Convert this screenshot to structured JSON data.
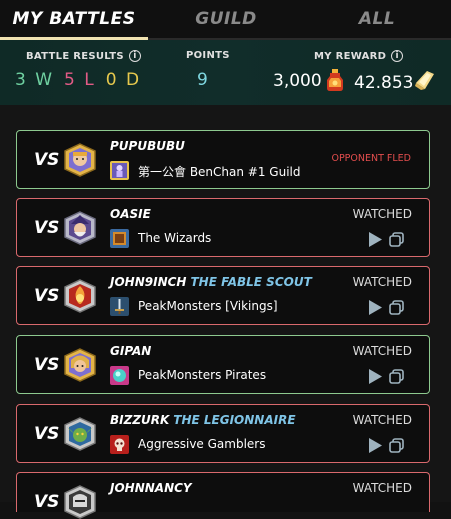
{
  "tabs": [
    {
      "label": "MY BATTLES",
      "active": true
    },
    {
      "label": "GUILD",
      "active": false
    },
    {
      "label": "ALL",
      "active": false
    }
  ],
  "stats": {
    "battle_results_label": "BATTLE RESULTS",
    "wins": "3 W",
    "losses": "5 L",
    "draws": "0 D",
    "points_label": "POINTS",
    "points": "9",
    "reward_label": "MY REWARD",
    "reward_dec": "3,000",
    "reward_sps": "42.853",
    "info_icon": "i"
  },
  "battles": [
    {
      "vs": "VS",
      "player": "PUPUBUBU",
      "title": "",
      "guild": "第一公會 BenChan #1 Guild",
      "status": "OPPONENT FLED",
      "result": "win",
      "avatar": "monk-avatar",
      "guild_icon": "purple-figure-icon"
    },
    {
      "vs": "VS",
      "player": "OASIE",
      "title": "",
      "guild": "The Wizards",
      "status": "WATCHED",
      "result": "loss",
      "avatar": "wizard-avatar",
      "guild_icon": "book-icon"
    },
    {
      "vs": "VS",
      "player": "JOHN9INCH",
      "title": "THE FABLE SCOUT",
      "guild": "PeakMonsters [Vikings]",
      "status": "WATCHED",
      "result": "loss",
      "avatar": "fire-avatar",
      "guild_icon": "sword-icon"
    },
    {
      "vs": "VS",
      "player": "GIPAN",
      "title": "",
      "guild": "PeakMonsters Pirates",
      "status": "WATCHED",
      "result": "win",
      "avatar": "elf-avatar",
      "guild_icon": "orb-icon"
    },
    {
      "vs": "VS",
      "player": "BIZZURK",
      "title": "THE LEGIONNAIRE",
      "guild": "Aggressive Gamblers",
      "status": "WATCHED",
      "result": "loss",
      "avatar": "goblin-avatar",
      "guild_icon": "skull-icon"
    },
    {
      "vs": "VS",
      "player": "JOHNNANCY",
      "title": "",
      "guild": "",
      "status": "WATCHED",
      "result": "loss",
      "avatar": "knight-avatar",
      "guild_icon": ""
    }
  ],
  "colors": {
    "win_border": "#8dc98f",
    "loss_border": "#d9696d",
    "fled": "#e24d4d",
    "title_accent": "#7fc4e6"
  }
}
